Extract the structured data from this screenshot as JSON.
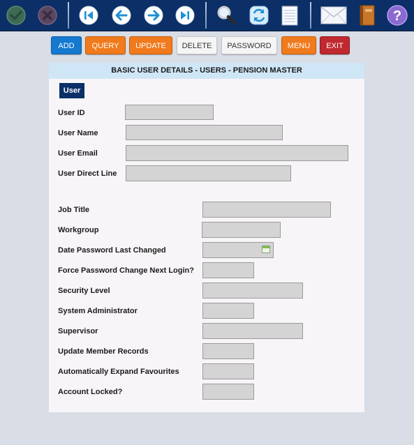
{
  "toolbar": {
    "icons": [
      "confirm-icon",
      "cancel-icon",
      "first-record-icon",
      "previous-record-icon",
      "next-record-icon",
      "last-record-icon",
      "search-icon",
      "refresh-icon",
      "notepad-icon",
      "mail-icon",
      "address-book-icon",
      "help-icon"
    ],
    "help_glyph": "?"
  },
  "actions": {
    "add": "ADD",
    "query": "QUERY",
    "update": "UPDATE",
    "delete": "DELETE",
    "password": "PASSWORD",
    "menu": "MENU",
    "exit": "EXIT"
  },
  "panel": {
    "title": "BASIC USER DETAILS - USERS - PENSION MASTER",
    "tab_label": "User"
  },
  "fields": {
    "user_id": {
      "label": "User ID",
      "value": ""
    },
    "user_name": {
      "label": "User Name",
      "value": ""
    },
    "user_email": {
      "label": "User Email",
      "value": ""
    },
    "user_direct_line": {
      "label": "User Direct Line",
      "value": ""
    },
    "job_title": {
      "label": "Job Title",
      "value": ""
    },
    "workgroup": {
      "label": "Workgroup",
      "value": ""
    },
    "date_password_last_changed": {
      "label": "Date Password Last Changed",
      "value": ""
    },
    "force_password_change": {
      "label": "Force Password Change Next Login?",
      "value": ""
    },
    "security_level": {
      "label": "Security Level",
      "value": ""
    },
    "system_administrator": {
      "label": "System Administrator",
      "value": ""
    },
    "supervisor": {
      "label": "Supervisor",
      "value": ""
    },
    "update_member_records": {
      "label": "Update Member Records",
      "value": ""
    },
    "auto_expand_favourites": {
      "label": "Automatically Expand Favourites",
      "value": ""
    },
    "account_locked": {
      "label": "Account Locked?",
      "value": ""
    }
  },
  "colors": {
    "toolbar_bg": "#0b2f66",
    "panel_header_bg": "#cfe6f7",
    "add_button": "#1479cf",
    "orange_button": "#f07a1c",
    "exit_button": "#c0292f"
  }
}
